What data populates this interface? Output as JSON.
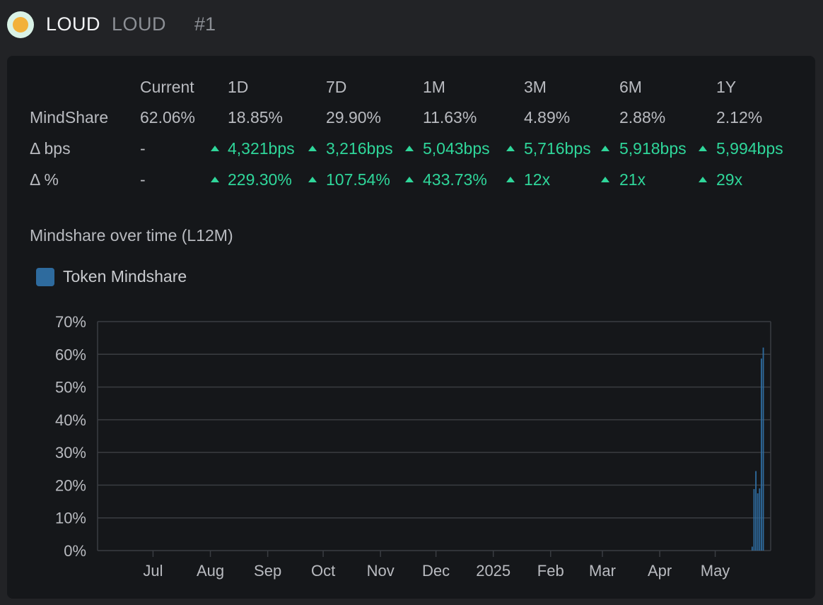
{
  "header": {
    "symbol": "LOUD",
    "name": "LOUD",
    "rank": "#1"
  },
  "stats": {
    "columns": [
      "Current",
      "1D",
      "7D",
      "1M",
      "3M",
      "6M",
      "1Y"
    ],
    "rows": [
      {
        "label": "MindShare",
        "values": [
          "62.06%",
          "18.85%",
          "29.90%",
          "11.63%",
          "4.89%",
          "2.88%",
          "2.12%"
        ],
        "up": [
          false,
          false,
          false,
          false,
          false,
          false,
          false
        ]
      },
      {
        "label": "Δ bps",
        "values": [
          "-",
          "4,321bps",
          "3,216bps",
          "5,043bps",
          "5,716bps",
          "5,918bps",
          "5,994bps"
        ],
        "up": [
          false,
          true,
          true,
          true,
          true,
          true,
          true
        ]
      },
      {
        "label": "Δ %",
        "values": [
          "-",
          "229.30%",
          "107.54%",
          "433.73%",
          "12x",
          "21x",
          "29x"
        ],
        "up": [
          false,
          true,
          true,
          true,
          true,
          true,
          true
        ]
      }
    ]
  },
  "colors": {
    "up": "#2fd69a",
    "bar": "#2e6b9e",
    "grid": "#3a3d42"
  },
  "chart_data": {
    "type": "bar",
    "title": "Mindshare over time (L12M)",
    "legend": [
      "Token Mindshare"
    ],
    "legend_position": "top-left",
    "x_tick_labels": [
      "Jul",
      "Aug",
      "Sep",
      "Oct",
      "Nov",
      "Dec",
      "2025",
      "Feb",
      "Mar",
      "Apr",
      "May"
    ],
    "y_tick_labels": [
      "0%",
      "10%",
      "20%",
      "30%",
      "40%",
      "50%",
      "60%",
      "70%"
    ],
    "ylim": [
      0,
      70
    ],
    "grid": true,
    "x_start": "2024-06-01",
    "x_end": "2025-05-31",
    "series": [
      {
        "name": "Token Mindshare",
        "points": [
          {
            "x": "2025-05-21",
            "y": 1.2
          },
          {
            "x": "2025-05-22",
            "y": 18.8
          },
          {
            "x": "2025-05-23",
            "y": 24.3
          },
          {
            "x": "2025-05-24",
            "y": 17.5
          },
          {
            "x": "2025-05-25",
            "y": 19.0
          },
          {
            "x": "2025-05-26",
            "y": 58.7
          },
          {
            "x": "2025-05-27",
            "y": 62.06
          }
        ]
      }
    ]
  }
}
